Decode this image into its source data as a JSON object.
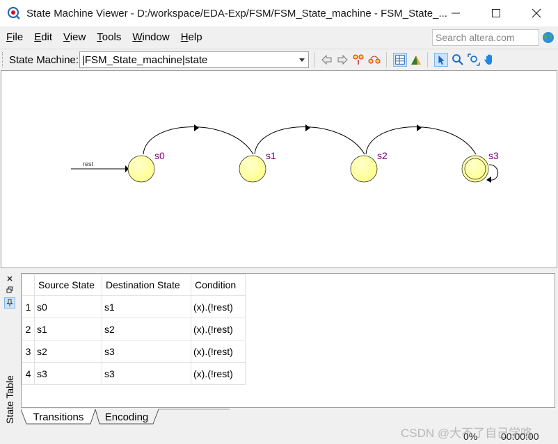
{
  "window": {
    "title": "State Machine Viewer - D:/workspace/EDA-Exp/FSM/FSM_State_machine - FSM_State_..."
  },
  "menu": [
    {
      "label": "File",
      "u": "F",
      "rest": "ile"
    },
    {
      "label": "Edit",
      "u": "E",
      "rest": "dit"
    },
    {
      "label": "View",
      "u": "V",
      "rest": "iew"
    },
    {
      "label": "Tools",
      "u": "T",
      "rest": "ools"
    },
    {
      "label": "Window",
      "u": "W",
      "rest": "indow"
    },
    {
      "label": "Help",
      "u": "H",
      "rest": "elp"
    }
  ],
  "search": {
    "placeholder": "Search altera.com"
  },
  "toolbar": {
    "state_machine_label": "State Machine:",
    "state_machine_value": "|FSM_State_machine|state"
  },
  "diagram": {
    "reset_label": "rest",
    "states": [
      "s0",
      "s1",
      "s2",
      "s3"
    ],
    "state_color": "#ffff99",
    "label_color": "#800080"
  },
  "state_table": {
    "panel_title": "State Table",
    "columns": [
      "Source State",
      "Destination State",
      "Condition"
    ],
    "rows": [
      {
        "num": "1",
        "source": "s0",
        "dest": "s1",
        "cond": "(x).(!rest)"
      },
      {
        "num": "2",
        "source": "s1",
        "dest": "s2",
        "cond": "(x).(!rest)"
      },
      {
        "num": "3",
        "source": "s2",
        "dest": "s3",
        "cond": "(x).(!rest)"
      },
      {
        "num": "4",
        "source": "s3",
        "dest": "s3",
        "cond": "(x).(!rest)"
      }
    ]
  },
  "tabs": [
    "Transitions",
    "Encoding"
  ],
  "status": {
    "progress": "0%",
    "time": "00:00:00"
  },
  "watermark": "CSDN @大不了自己学咯"
}
